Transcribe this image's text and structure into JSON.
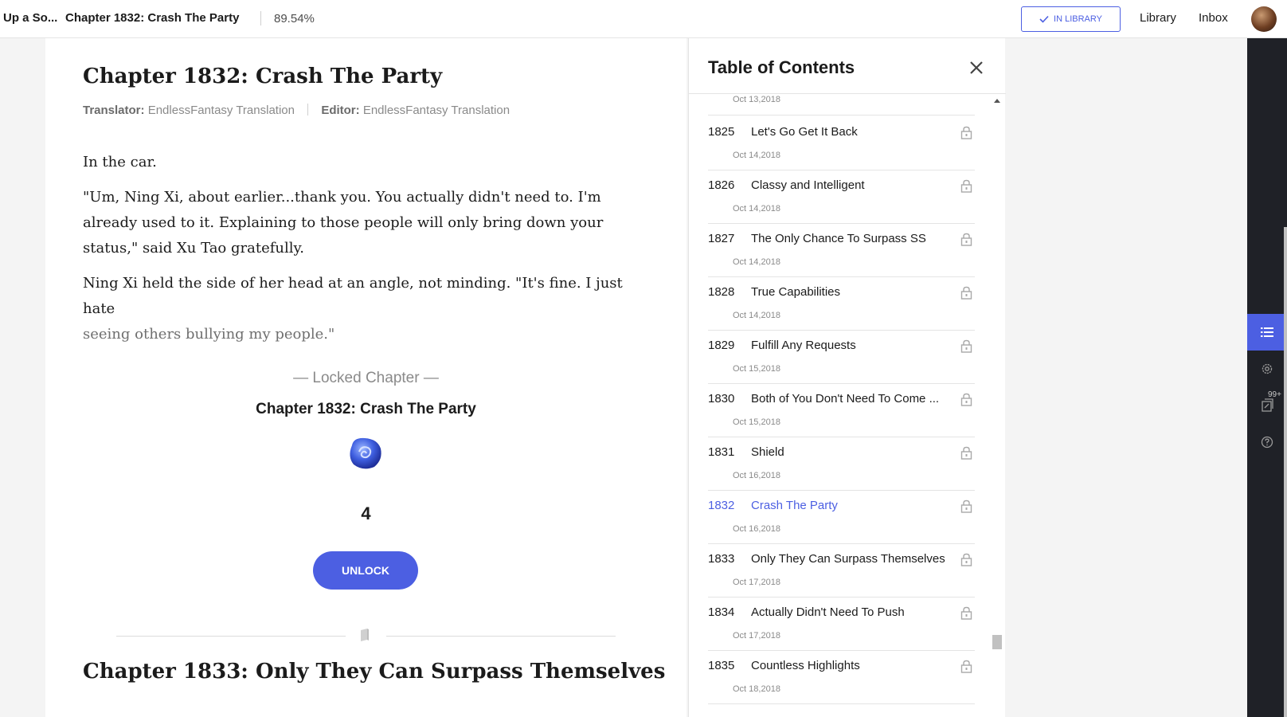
{
  "topbar": {
    "novel_title": "Up a So...",
    "chapter_title": "Chapter 1832: Crash The Party",
    "progress": "89.54%",
    "in_library_label": "IN LIBRARY",
    "library_label": "Library",
    "inbox_label": "Inbox"
  },
  "chapter": {
    "heading": "Chapter 1832: Crash The Party",
    "translator_label": "Translator:",
    "translator": "EndlessFantasy Translation",
    "editor_label": "Editor:",
    "editor": "EndlessFantasy Translation",
    "paragraphs": [
      "In the car.",
      "\"Um, Ning Xi, about earlier...thank you. You actually didn't need to. I'm already used to it. Explaining to those people will only bring down your status,\" said Xu Tao gratefully.",
      "Ning Xi held the side of her head at an angle, not minding. \"It's fine. I just hate",
      "seeing others bullying my people.\""
    ]
  },
  "locked": {
    "label": "— Locked Chapter —",
    "title": "Chapter 1832: Crash The Party",
    "cost": "4",
    "unlock_label": "UNLOCK"
  },
  "next_chapter": {
    "heading": "Chapter 1833: Only They Can Surpass Themselves"
  },
  "toc": {
    "title": "Table of Contents",
    "first_date": "Oct 13,2018",
    "items": [
      {
        "num": "1825",
        "name": "Let's Go Get It Back",
        "date": "Oct 14,2018"
      },
      {
        "num": "1826",
        "name": "Classy and Intelligent",
        "date": "Oct 14,2018"
      },
      {
        "num": "1827",
        "name": "The Only Chance To Surpass SS",
        "date": "Oct 14,2018"
      },
      {
        "num": "1828",
        "name": "True Capabilities",
        "date": "Oct 14,2018"
      },
      {
        "num": "1829",
        "name": "Fulfill Any Requests",
        "date": "Oct 15,2018"
      },
      {
        "num": "1830",
        "name": "Both of You Don't Need To Come ...",
        "date": "Oct 15,2018"
      },
      {
        "num": "1831",
        "name": "Shield",
        "date": "Oct 16,2018"
      },
      {
        "num": "1832",
        "name": "Crash The Party",
        "date": "Oct 16,2018"
      },
      {
        "num": "1833",
        "name": "Only They Can Surpass Themselves",
        "date": "Oct 17,2018"
      },
      {
        "num": "1834",
        "name": "Actually Didn't Need To Push",
        "date": "Oct 17,2018"
      },
      {
        "num": "1835",
        "name": "Countless Highlights",
        "date": "Oct 18,2018"
      }
    ]
  },
  "rail": {
    "badge": "99+"
  },
  "colors": {
    "accent": "#4c5fe2",
    "rail_bg": "#1f2127"
  },
  "icons": [
    "check-icon",
    "close-icon",
    "lock-icon",
    "gem-icon",
    "book-icon",
    "list-icon",
    "gear-icon",
    "library-icon",
    "help-icon"
  ]
}
